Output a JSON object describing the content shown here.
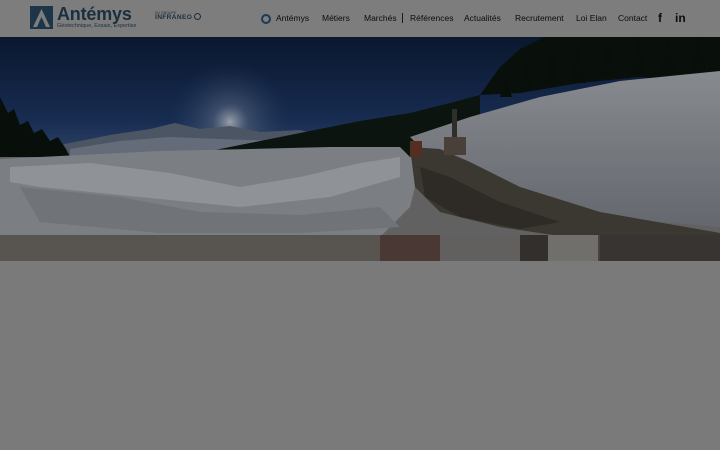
{
  "brand": {
    "name": "Antémys",
    "group_prefix": "DU GROUPE",
    "group_name": "INFRANEO",
    "tagline": "Géotechnique, Essais, Expertise"
  },
  "nav": {
    "items": [
      {
        "label": "Antémys",
        "active": true
      },
      {
        "label": "Métiers"
      },
      {
        "label": "Marchés"
      },
      {
        "label": "Références"
      },
      {
        "label": "Actualités"
      },
      {
        "label": "Recrutement"
      },
      {
        "label": "Loi Elan"
      },
      {
        "label": "Contact"
      }
    ]
  },
  "social": {
    "facebook": "f",
    "linkedin": "in"
  },
  "colors": {
    "brand_navy": "#1a2f40",
    "overlay_gray": "#7a7a7a"
  }
}
